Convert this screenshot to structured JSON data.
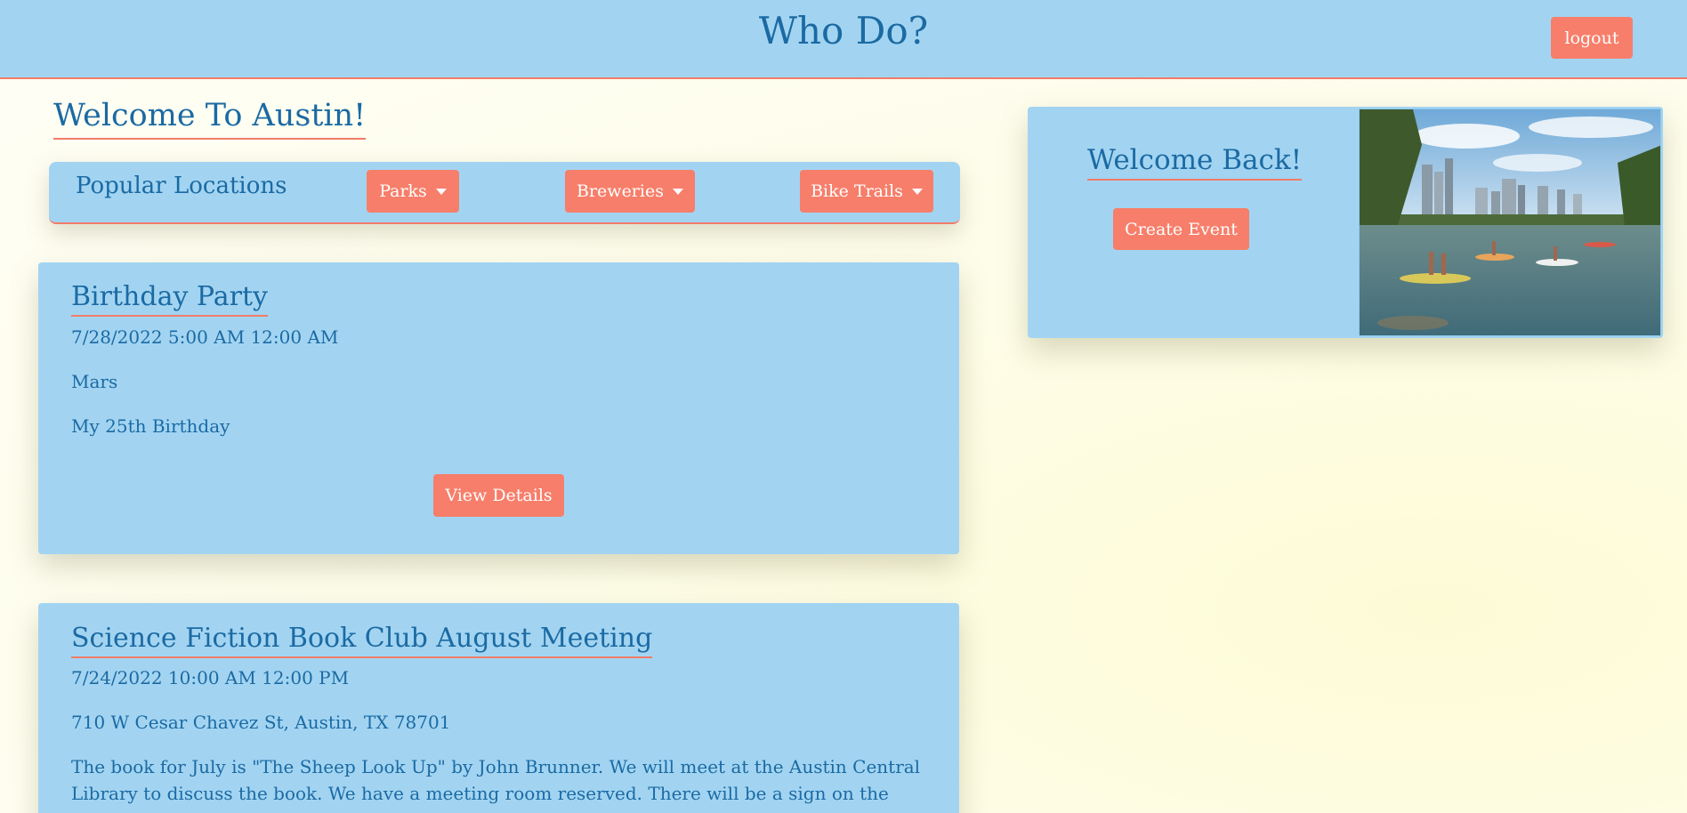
{
  "header": {
    "site_title": "Who Do?",
    "logout_label": "logout"
  },
  "main": {
    "welcome_heading": "Welcome To Austin!",
    "popular": {
      "label": "Popular Locations",
      "dropdowns": [
        {
          "label": "Parks"
        },
        {
          "label": "Breweries"
        },
        {
          "label": "Bike Trails"
        }
      ]
    },
    "events": [
      {
        "title": "Birthday Party",
        "datetime": "7/28/2022 5:00 AM 12:00 AM",
        "location": "Mars",
        "description": "My 25th Birthday",
        "button_label": "View Details"
      },
      {
        "title": "Science Fiction Book Club August Meeting",
        "datetime": "7/24/2022 10:00 AM 12:00 PM",
        "location": "710 W Cesar Chavez St, Austin, TX 78701",
        "description": "The book for July is \"The Sheep Look Up\" by John Brunner. We will meet at the Austin Central Library to discuss the book. We have a meeting room reserved. There will be a sign on the door. If you can't"
      }
    ]
  },
  "sidebar": {
    "welcome_back": "Welcome Back!",
    "create_event_label": "Create Event"
  },
  "colors": {
    "panel": "#a2d4f2",
    "accent": "#f77e6a",
    "text": "#1b6aa3"
  }
}
